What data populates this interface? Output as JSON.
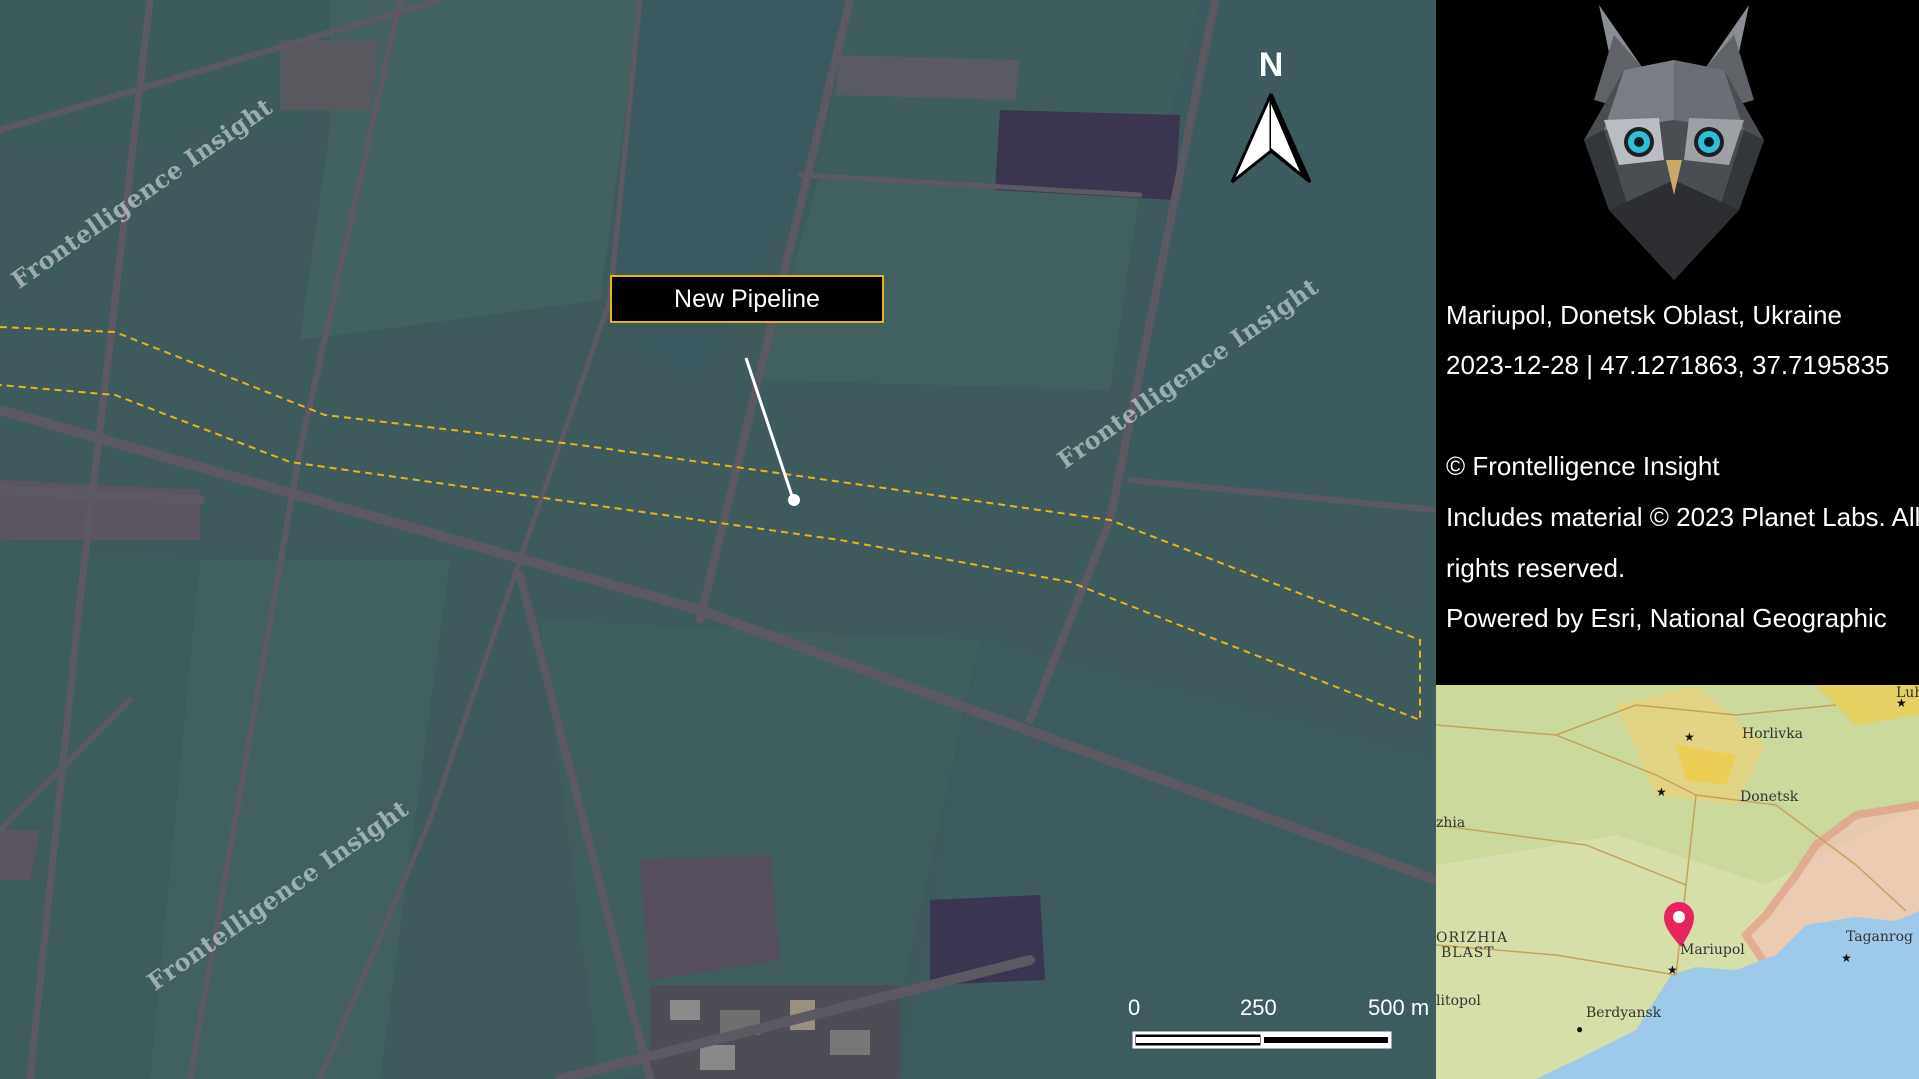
{
  "map": {
    "callout_label": "New Pipeline",
    "north_label": "N",
    "watermark": "Frontelligence Insight",
    "scale": {
      "labels": [
        "0",
        "250",
        "500 m"
      ]
    }
  },
  "panel": {
    "location": "Mariupol, Donetsk Oblast, Ukraine",
    "date_coords": "2023-12-28 | 47.1271863, 37.7195835",
    "copyright": "© Frontelligence Insight",
    "material_line1": "Includes material © 2023 Planet Labs. All",
    "material_line2": "rights reserved.",
    "powered_by": "Powered by Esri, National Geographic"
  },
  "inset": {
    "cities": {
      "horlivka": "Horlivka",
      "donetsk": "Donetsk",
      "mariupol": "Mariupol",
      "taganrog": "Taganrog",
      "berdyansk": "Berdyansk",
      "luh": "Luh",
      "zhia": "zhia",
      "orizhia": "ORIZHIA",
      "blast": "BLAST",
      "litopol": "litopol"
    }
  },
  "colors": {
    "pipeline_outline": "#e8b21d",
    "marker": "#e8245e",
    "sea": "#9ec9e8",
    "land": "#d7dfa8"
  }
}
